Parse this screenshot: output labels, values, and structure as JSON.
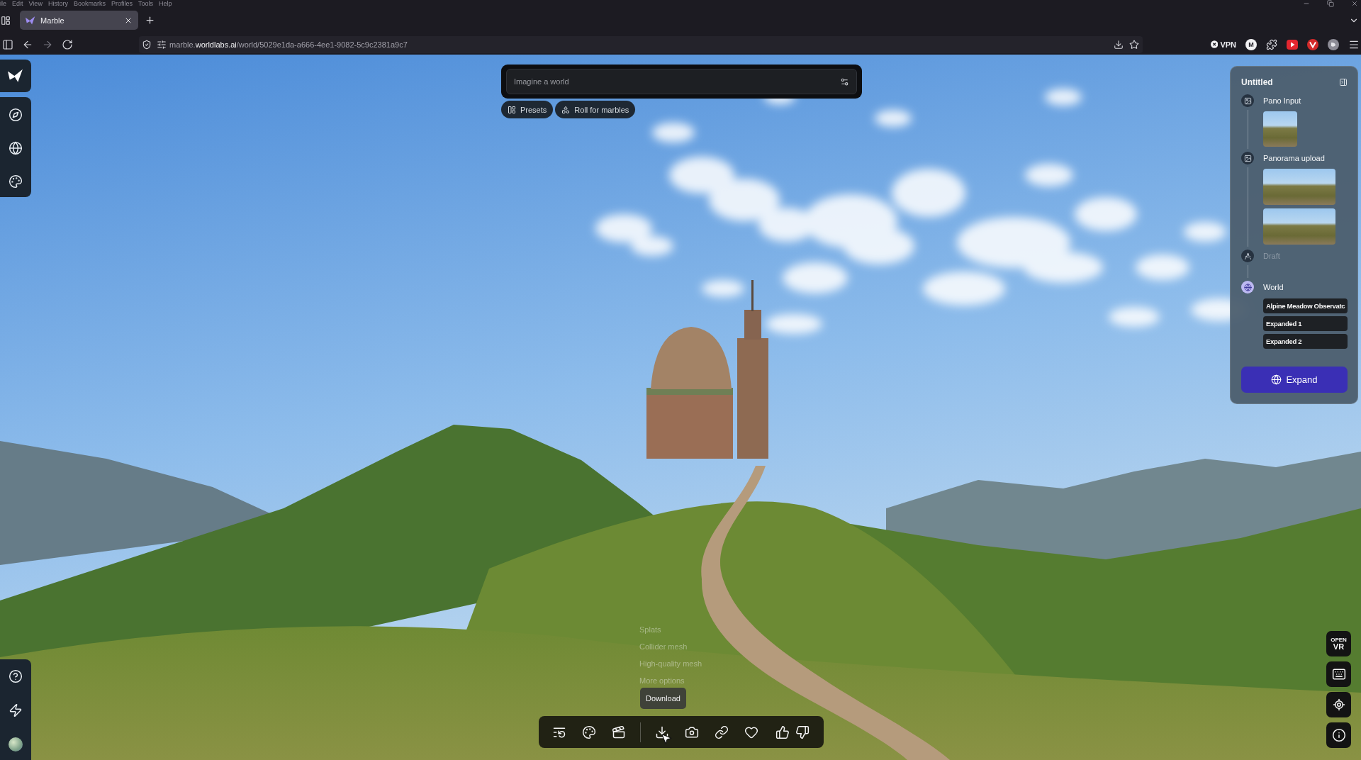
{
  "browser": {
    "menu": [
      "ile",
      "Edit",
      "View",
      "History",
      "Bookmarks",
      "Profiles",
      "Tools",
      "Help"
    ],
    "tabs": [
      {
        "title": "Marble",
        "selected": true
      }
    ],
    "address": "marble.**worldlabs.ai**/world/5029e1da-a666-4ee1-9082-5c9c2381a9c7",
    "vpn": "VPN",
    "extension_badge": "M"
  },
  "composer": {
    "placeholder": "Imagine a world",
    "chips": [
      "Presets",
      "Roll for marbles"
    ]
  },
  "panel": {
    "title": "Untitled",
    "steps": [
      {
        "kind": "image",
        "label": "Pano Input",
        "selected": false,
        "disabled": false,
        "images": [
          {
            "kind": "square"
          }
        ]
      },
      {
        "kind": "image",
        "label": "Panorama upload",
        "selected": false,
        "disabled": false,
        "images": [
          {
            "kind": "wide"
          },
          {
            "kind": "wide"
          }
        ]
      },
      {
        "kind": "draft",
        "label": "Draft",
        "selected": false,
        "disabled": true
      },
      {
        "kind": "world",
        "label": "World",
        "selected": true,
        "disabled": false,
        "versions": [
          "Alpine Meadow Observatc",
          "Expanded 1",
          "Expanded 2"
        ]
      }
    ],
    "action": "Expand"
  },
  "download_menu": {
    "items": [
      "Splats",
      "Collider mesh",
      "High-quality mesh",
      "More options"
    ],
    "tooltip": "Download"
  },
  "view_controls": {
    "vr": {
      "top": "OPEN",
      "bottom": "VR"
    }
  }
}
